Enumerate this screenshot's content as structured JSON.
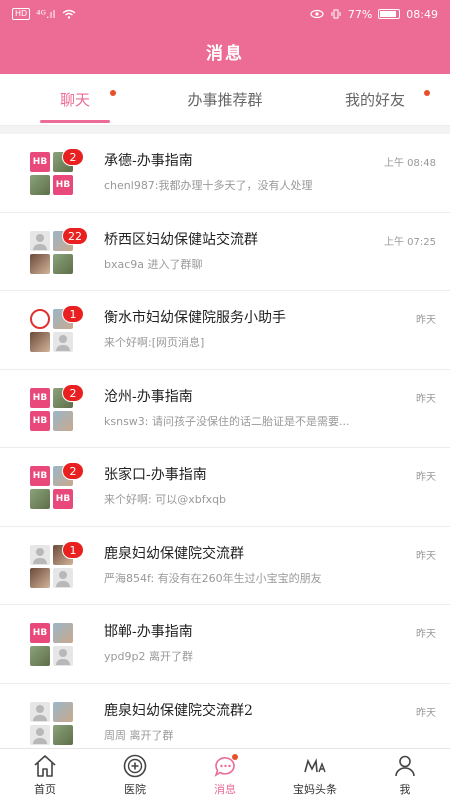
{
  "status_bar": {
    "left_chip": "HD",
    "signal": "⁴ᴳ.ıl",
    "battery_pct": "77%",
    "time": "08:49",
    "battery_level": 0.77
  },
  "header": {
    "title": "消息"
  },
  "tabs": [
    {
      "label": "聊天",
      "active": true,
      "dot": true
    },
    {
      "label": "办事推荐群",
      "active": false,
      "dot": false
    },
    {
      "label": "我的好友",
      "active": false,
      "dot": true
    }
  ],
  "chats": [
    {
      "title": "承德-办事指南",
      "subtitle": "chenl987:我都办理十多天了，没有人处理",
      "time": "上午 08:48",
      "badge": "2",
      "avatar": [
        "hb",
        "photo",
        "photo",
        "hb"
      ]
    },
    {
      "title": "桥西区妇幼保健站交流群",
      "subtitle": "bxac9a 进入了群聊",
      "time": "上午 07:25",
      "badge": "22",
      "avatar": [
        "person",
        "photo2",
        "photo3",
        "photo"
      ]
    },
    {
      "title": "衡水市妇幼保健院服务小助手",
      "subtitle": "来个好啊:[网页消息]",
      "time": "昨天",
      "badge": "1",
      "avatar": [
        "seal",
        "photo2",
        "photo3",
        "person"
      ]
    },
    {
      "title": "沧州-办事指南",
      "subtitle": "ksnsw3: 请问孩子没保住的话二胎证是不是需要...",
      "time": "昨天",
      "badge": "2",
      "avatar": [
        "hb",
        "photo",
        "hb",
        "photo2"
      ]
    },
    {
      "title": "张家口-办事指南",
      "subtitle": "来个好啊: 可以@xbfxqb",
      "time": "昨天",
      "badge": "2",
      "avatar": [
        "hb",
        "photo2",
        "photo",
        "hb"
      ]
    },
    {
      "title": "鹿泉妇幼保健院交流群",
      "subtitle": "严海854f: 有没有在260年生过小宝宝的朋友",
      "time": "昨天",
      "badge": "1",
      "avatar": [
        "person",
        "photo3",
        "photo3",
        "person"
      ]
    },
    {
      "title": "邯郸-办事指南",
      "subtitle": "ypd9p2 离开了群",
      "time": "昨天",
      "badge": "",
      "avatar": [
        "hb",
        "photo2",
        "photo",
        "person"
      ]
    },
    {
      "title": "鹿泉妇幼保健院交流群2",
      "subtitle": "周周 离开了群",
      "time": "昨天",
      "badge": "",
      "avatar": [
        "person",
        "photo2",
        "person",
        "photo"
      ]
    }
  ],
  "bottom_nav": [
    {
      "label": "首页",
      "icon": "home-icon",
      "active": false
    },
    {
      "label": "医院",
      "icon": "hospital-icon",
      "active": false
    },
    {
      "label": "消息",
      "icon": "message-icon",
      "active": true,
      "dot": true
    },
    {
      "label": "宝妈头条",
      "icon": "ma-icon",
      "active": false
    },
    {
      "label": "我",
      "icon": "user-icon",
      "active": false
    }
  ],
  "colors": {
    "brand": "#ec6c95",
    "badge": "#e82020",
    "dot": "#e8502a"
  }
}
